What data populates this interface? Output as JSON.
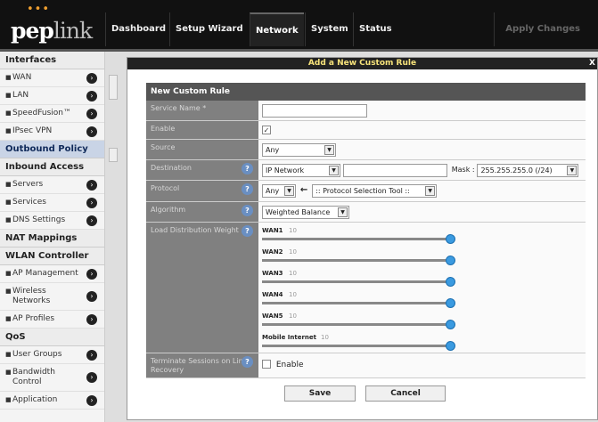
{
  "logo": {
    "dots": "•••",
    "text_main": "pep",
    "text_sub": "link"
  },
  "topnav": {
    "items": [
      {
        "label": "Dashboard"
      },
      {
        "label": "Setup Wizard"
      },
      {
        "label": "Network"
      },
      {
        "label": "System"
      },
      {
        "label": "Status"
      }
    ],
    "apply_label": "Apply Changes"
  },
  "sidebar": {
    "interfaces": "Interfaces",
    "wan": "WAN",
    "lan": "LAN",
    "speedfusion": "SpeedFusion™",
    "ipsec": "IPsec VPN",
    "outbound": "Outbound Policy",
    "inbound": "Inbound Access",
    "servers": "Servers",
    "services": "Services",
    "dns": "DNS Settings",
    "nat": "NAT Mappings",
    "wlan": "WLAN Controller",
    "ap_mgmt": "AP Management",
    "wireless": "Wireless Networks",
    "ap_profiles": "AP Profiles",
    "qos": "QoS",
    "user_groups": "User Groups",
    "bandwidth": "Bandwidth Control",
    "application": "Application"
  },
  "dialog": {
    "title": "Add a New Custom Rule",
    "close": "X",
    "section_header": "New Custom Rule",
    "service_name_label": "Service Name *",
    "service_name_value": "",
    "enable_label": "Enable",
    "enable_checked": "✓",
    "source_label": "Source",
    "source_value": "Any",
    "destination_label": "Destination",
    "destination_type": "IP Network",
    "destination_ip": "",
    "mask_label": "Mask :",
    "mask_value": "255.255.255.0 (/24)",
    "protocol_label": "Protocol",
    "protocol_value": "Any",
    "protocol_tool": ":: Protocol Selection Tool ::",
    "algorithm_label": "Algorithm",
    "algorithm_value": "Weighted Balance",
    "load_label": "Load Distribution Weight",
    "wans": [
      {
        "name": "WAN1",
        "weight": "10"
      },
      {
        "name": "WAN2",
        "weight": "10"
      },
      {
        "name": "WAN3",
        "weight": "10"
      },
      {
        "name": "WAN4",
        "weight": "10"
      },
      {
        "name": "WAN5",
        "weight": "10"
      },
      {
        "name": "Mobile Internet",
        "weight": "10"
      }
    ],
    "terminate_label": "Terminate Sessions on Link Recovery",
    "terminate_enable": "Enable",
    "save": "Save",
    "cancel": "Cancel",
    "help": "?",
    "dropdown": "▼",
    "arrow": "←"
  },
  "colors": {
    "accent": "#3a9ae0",
    "title_text": "#f6e27a",
    "active_sidebar": "#c9d4e6"
  }
}
